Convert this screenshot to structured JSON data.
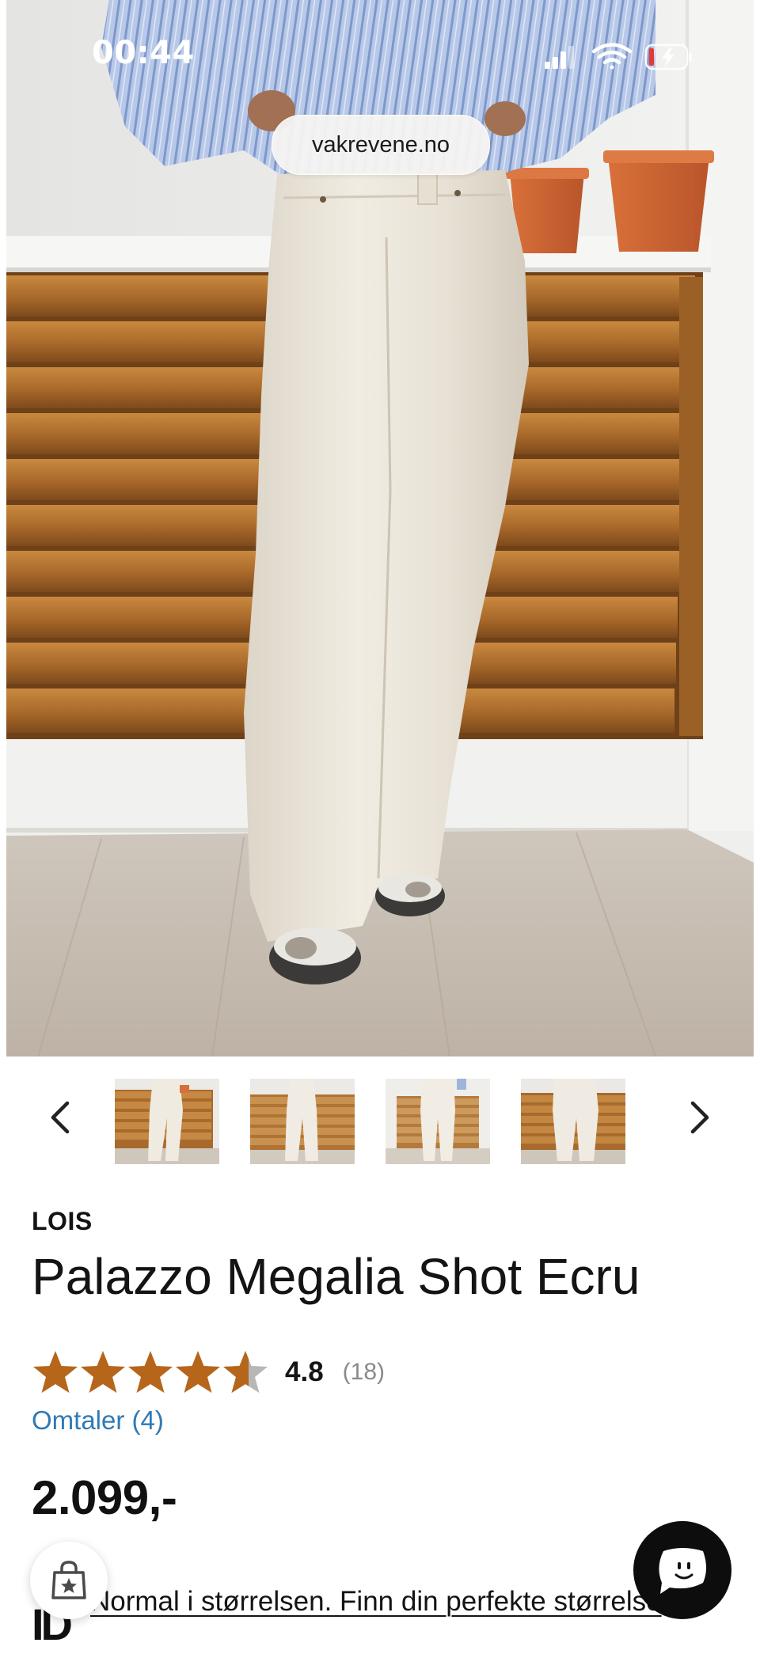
{
  "status_bar": {
    "time": "00:44"
  },
  "browser": {
    "url": "vakrevene.no"
  },
  "gallery": {
    "main_image_alt": "woman wearing ecru wide-leg palazzo jeans in front of wooden slat cabinet",
    "thumbnails": [
      {
        "name": "thumbnail-1"
      },
      {
        "name": "thumbnail-2"
      },
      {
        "name": "thumbnail-3"
      },
      {
        "name": "thumbnail-4"
      }
    ],
    "prev_icon": "chevron-left-icon",
    "next_icon": "chevron-right-icon"
  },
  "product": {
    "brand": "LOIS",
    "title": "Palazzo Megalia Shot Ecru",
    "rating": 4.8,
    "rating_text": "4.8",
    "rating_count": "(18)",
    "reviews_link": "Omtaler (4)",
    "price": "2.099,-",
    "fit_icon_text": "ID",
    "fit_text": "Normal i størrelsen. Finn din perfekte størrelse"
  },
  "colors": {
    "star": "#b5661a",
    "star_empty": "#b7b7b7",
    "link": "#2f7ab5",
    "chat_bg": "#0d0d0d"
  },
  "icons": {
    "bag": "shopping-bag-star-icon",
    "chat": "chat-face-icon"
  }
}
